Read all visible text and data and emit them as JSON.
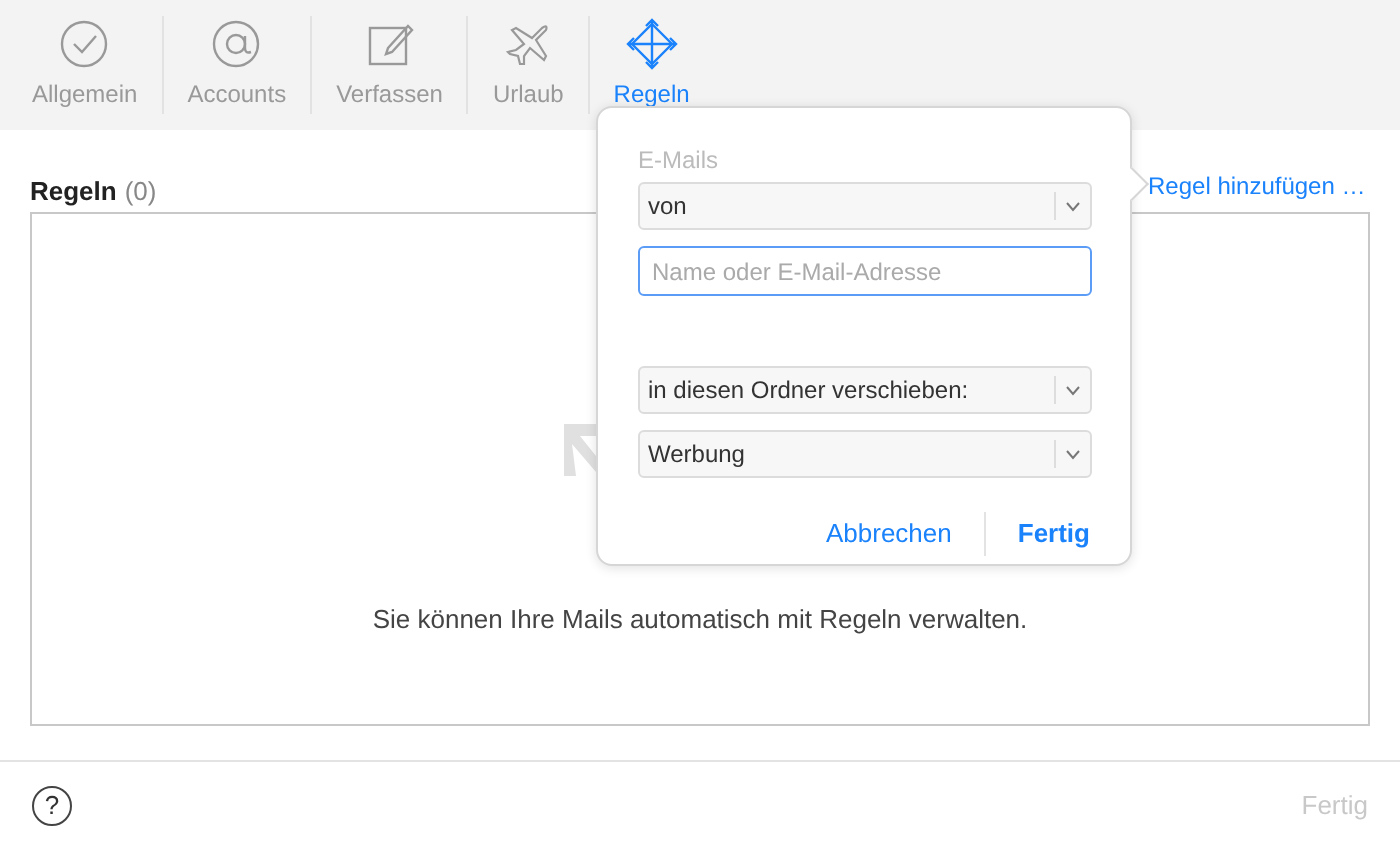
{
  "toolbar": {
    "tabs": [
      {
        "label": "Allgemein",
        "selected": false
      },
      {
        "label": "Accounts",
        "selected": false
      },
      {
        "label": "Verfassen",
        "selected": false
      },
      {
        "label": "Urlaub",
        "selected": false
      },
      {
        "label": "Regeln",
        "selected": true
      }
    ]
  },
  "rules": {
    "title": "Regeln",
    "count": "(0)",
    "add_link": "Regel hinzufügen …",
    "empty_message": "Sie können Ihre Mails automatisch mit Regeln verwalten."
  },
  "popover": {
    "section_label": "E-Mails",
    "condition_select": "von",
    "address_field": {
      "placeholder": "Name oder E-Mail-Adresse"
    },
    "action_select": "in diesen Ordner verschieben:",
    "folder_select": "Werbung",
    "buttons": {
      "cancel": "Abbrechen",
      "done": "Fertig"
    }
  },
  "footer": {
    "help": "?",
    "done": {
      "label": "Fertig",
      "disabled": true
    }
  }
}
